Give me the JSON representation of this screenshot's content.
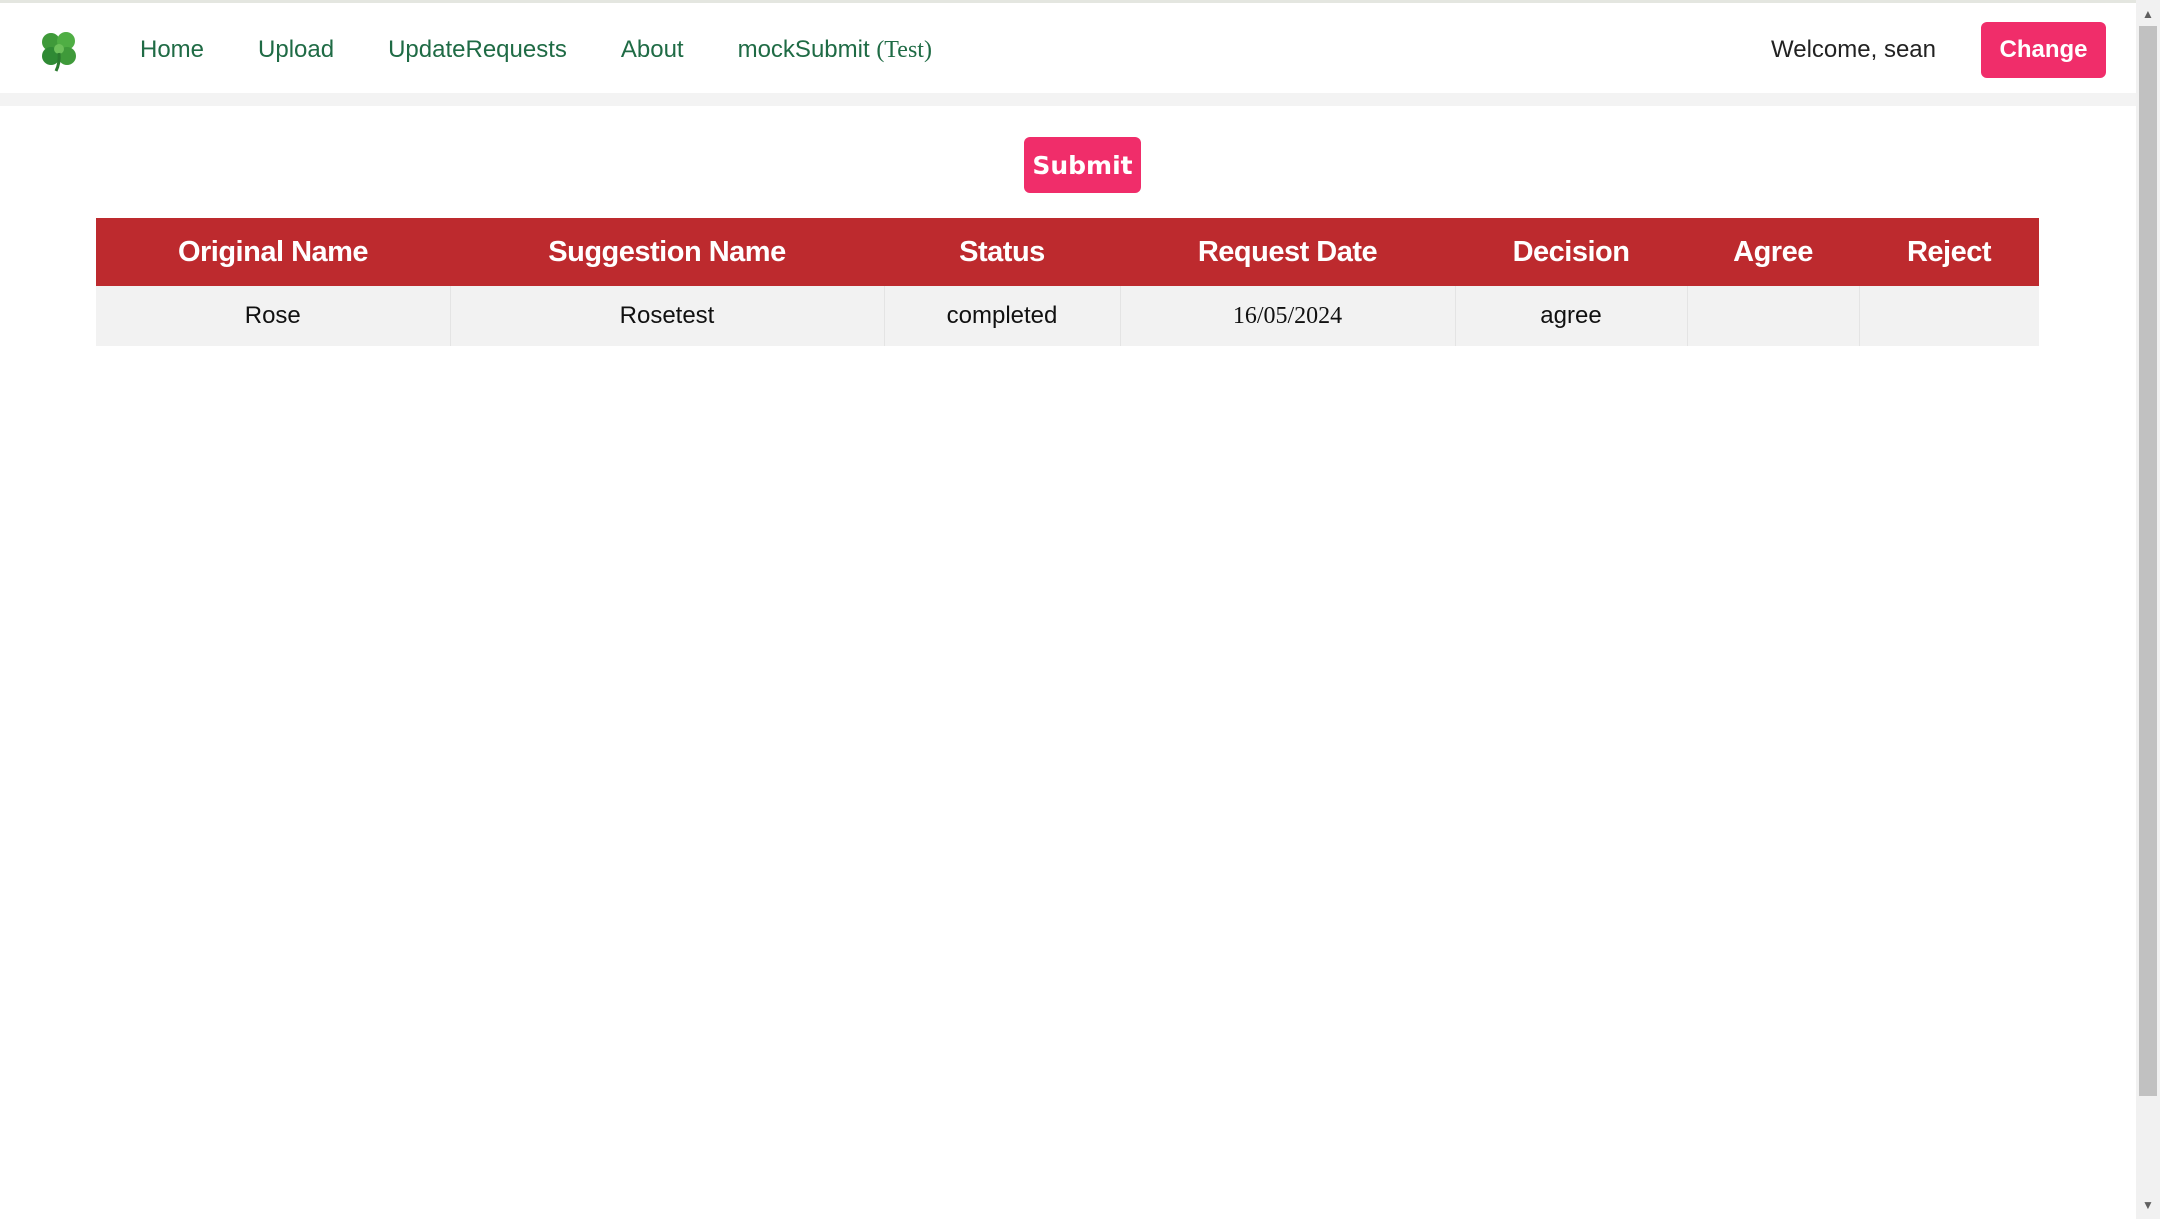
{
  "nav": {
    "logo_icon": "clover-icon",
    "links": [
      "Home",
      "Upload",
      "UpdateRequests",
      "About"
    ],
    "mock_label": "mockSubmit",
    "mock_suffix": "(Test)",
    "welcome": "Welcome, sean",
    "change_label": "Change"
  },
  "actions": {
    "submit_label": "Submit"
  },
  "table": {
    "headers": [
      "Original Name",
      "Suggestion Name",
      "Status",
      "Request Date",
      "Decision",
      "Agree",
      "Reject"
    ],
    "rows": [
      {
        "original": "Rose",
        "suggestion": "Rosetest",
        "status": "completed",
        "date": "16/05/2024",
        "decision": "agree",
        "agree": "",
        "reject": ""
      }
    ]
  },
  "colors": {
    "brand_green": "#1f6b45",
    "accent_pink": "#f02d6a",
    "header_red": "#bd2a2e",
    "row_bg": "#f2f2f2"
  }
}
